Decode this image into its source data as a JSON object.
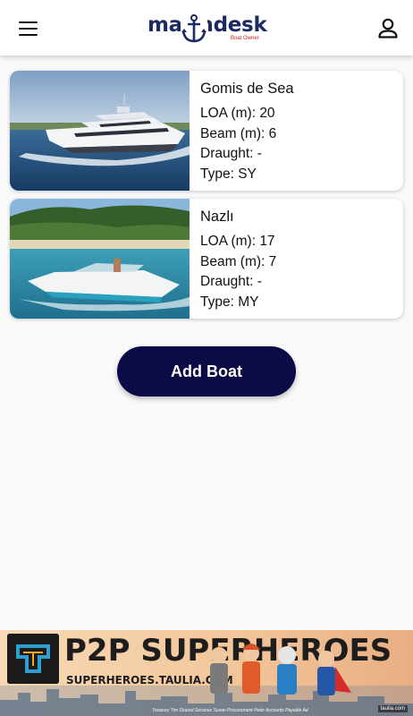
{
  "app": {
    "logo_text": "marindesk",
    "logo_subtitle": "Boat Owner"
  },
  "icons": {
    "menu": "hamburger-menu-icon",
    "profile": "person-icon",
    "logo_mark": "anchor-icon"
  },
  "colors": {
    "primary_button": "#0b0b46",
    "logo_navy": "#1b2a63",
    "logo_red": "#cc1f1f"
  },
  "boats": [
    {
      "name": "Gomis de Sea",
      "loa": "LOA (m): 20",
      "beam": "Beam (m): 6",
      "draught": "Draught: -",
      "type": "Type: SY"
    },
    {
      "name": "Nazlı",
      "loa": "LOA (m): 17",
      "beam": "Beam (m): 7",
      "draught": "Draught: -",
      "type": "Type: MY"
    }
  ],
  "actions": {
    "add_boat": "Add Boat"
  },
  "ad": {
    "title": "P2P SUPERHEROES",
    "url": "SUPERHEROES.TAULIA.COM",
    "captions": "Treasury Tim   Shared Services Susan   Procurement Peter   Accounts Payable Ad",
    "badge": "taulia.com"
  }
}
